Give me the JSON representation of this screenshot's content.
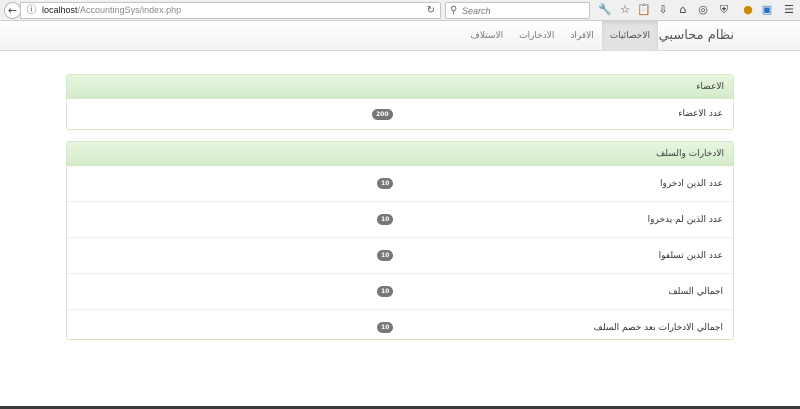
{
  "browser": {
    "url_host": "localhost",
    "url_path": "/AccountingSys/index.php",
    "search_placeholder": "Search"
  },
  "navbar": {
    "brand": "نظام محاسبي",
    "links": [
      {
        "label": "الاحصائيات",
        "active": true
      },
      {
        "label": "الافراد",
        "active": false
      },
      {
        "label": "الادخارات",
        "active": false
      },
      {
        "label": "الاستلاف",
        "active": false
      }
    ]
  },
  "members_panel": {
    "title": "الاعضاء",
    "rows": [
      {
        "label": "عدد الاعضاء",
        "badge": "200"
      }
    ]
  },
  "savings_panel": {
    "title": "الادخارات والسلف",
    "rows": [
      {
        "label": "عدد الذين ادخروا",
        "badge": "10"
      },
      {
        "label": "عدد الذين لم يدخروا",
        "badge": "10"
      },
      {
        "label": "عدد الذين تسلفوا",
        "badge": "10"
      },
      {
        "label": "اجمالي السلف",
        "badge": "10"
      },
      {
        "label": "اجمالي الادخارات بعد خصم السلف",
        "badge": "10"
      }
    ]
  }
}
